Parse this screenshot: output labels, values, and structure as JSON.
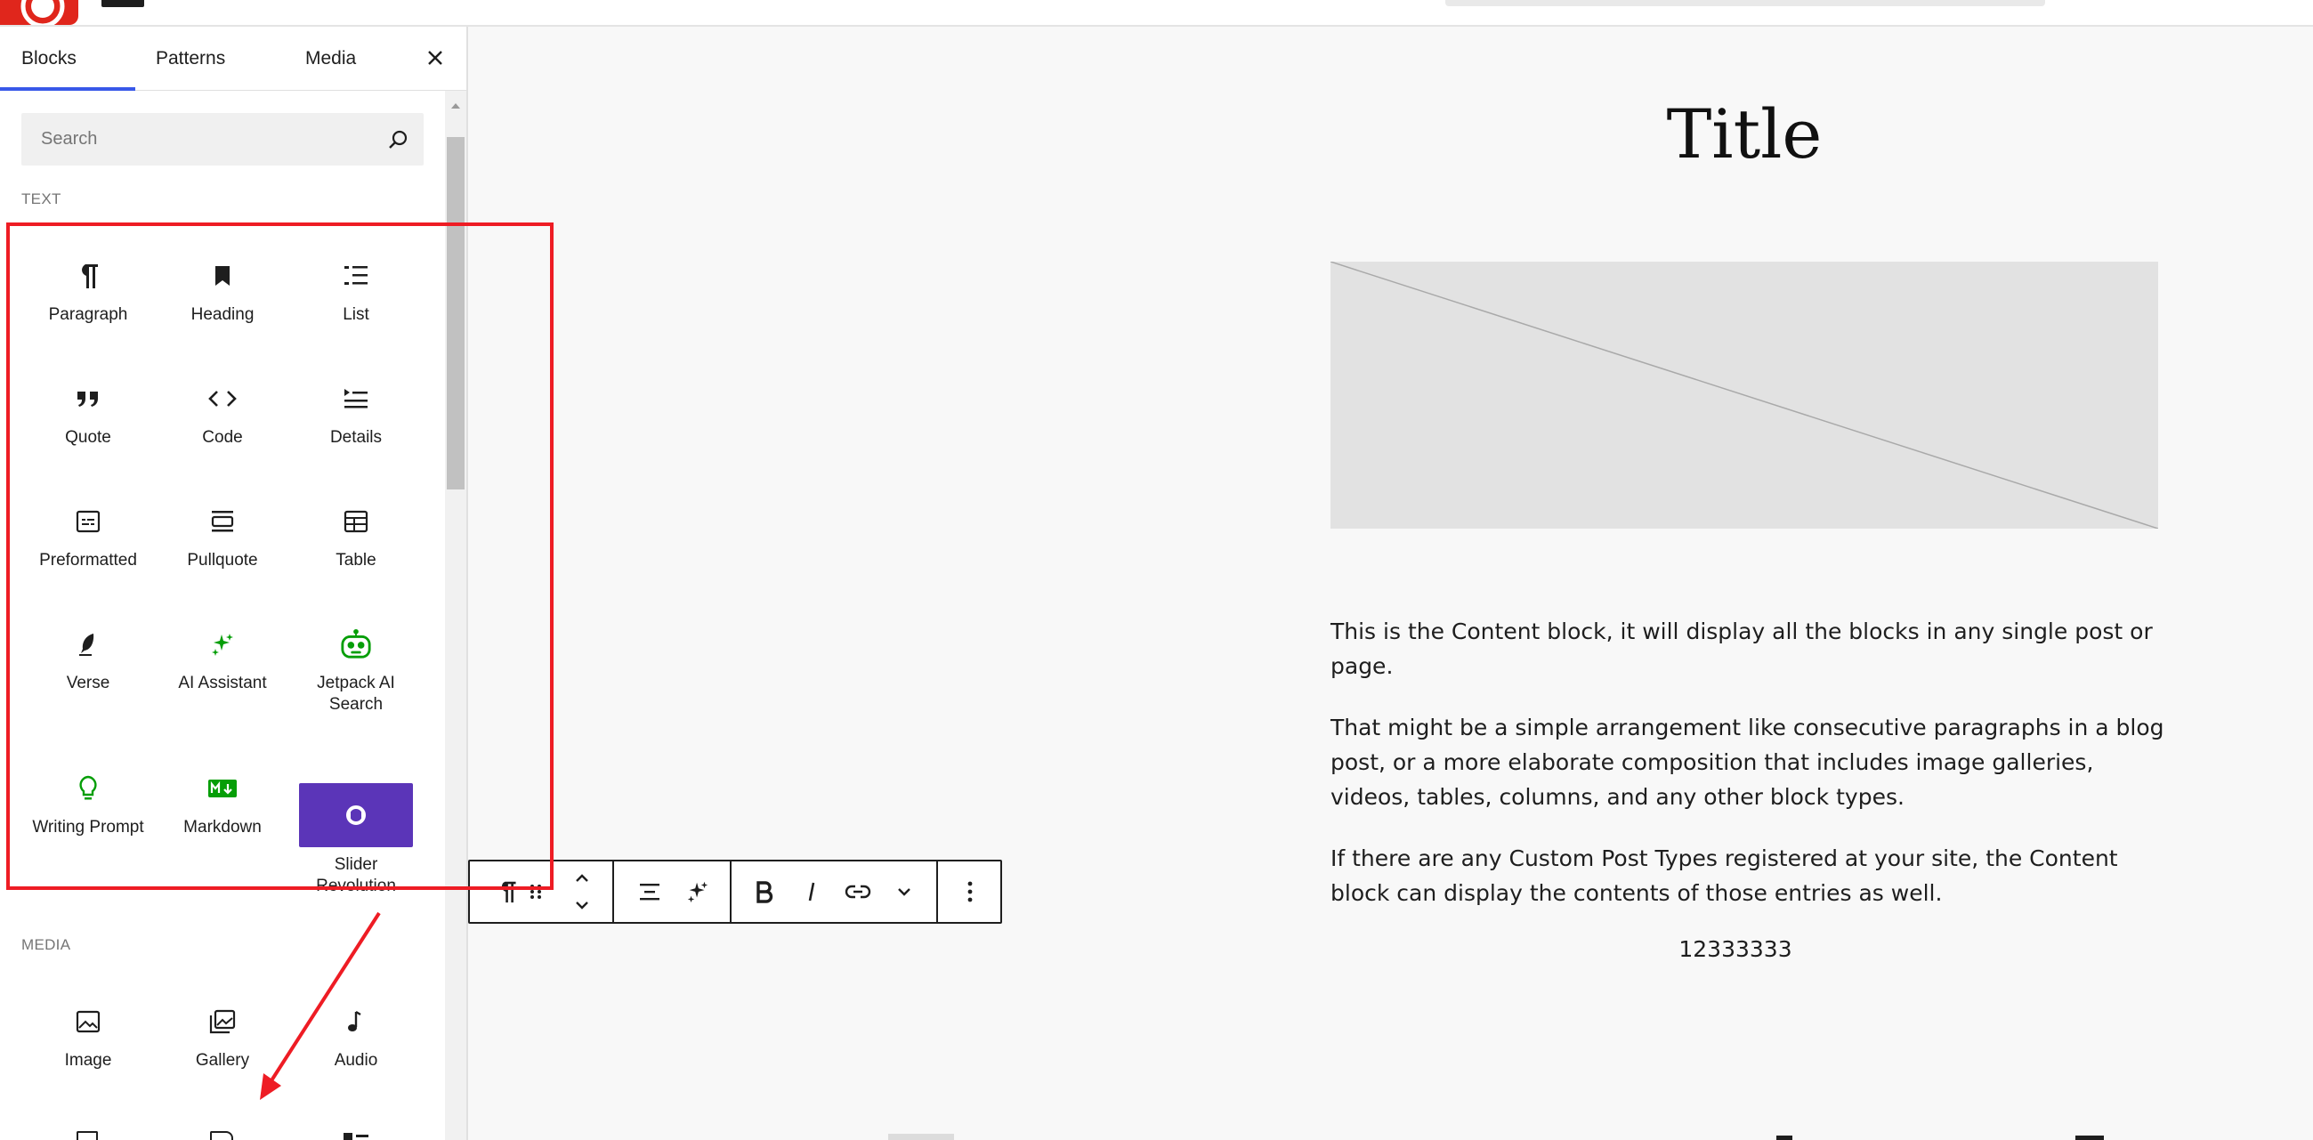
{
  "sidebar": {
    "tabs": [
      {
        "label": "Blocks"
      },
      {
        "label": "Patterns"
      },
      {
        "label": "Media"
      }
    ],
    "search_placeholder": "Search",
    "categories": {
      "text": "TEXT",
      "media": "MEDIA"
    },
    "text_blocks": [
      {
        "label": "Paragraph",
        "icon": "paragraph-icon"
      },
      {
        "label": "Heading",
        "icon": "heading-icon"
      },
      {
        "label": "List",
        "icon": "list-icon"
      },
      {
        "label": "Quote",
        "icon": "quote-icon"
      },
      {
        "label": "Code",
        "icon": "code-icon"
      },
      {
        "label": "Details",
        "icon": "details-icon"
      },
      {
        "label": "Preformatted",
        "icon": "preformatted-icon"
      },
      {
        "label": "Pullquote",
        "icon": "pullquote-icon"
      },
      {
        "label": "Table",
        "icon": "table-icon"
      },
      {
        "label": "Verse",
        "icon": "verse-icon"
      },
      {
        "label": "AI Assistant",
        "icon": "ai-assistant-icon"
      },
      {
        "label": "Jetpack AI Search",
        "icon": "jetpack-ai-search-icon"
      },
      {
        "label": "Writing Prompt",
        "icon": "writing-prompt-icon"
      },
      {
        "label": "Markdown",
        "icon": "markdown-icon"
      },
      {
        "label": "Slider Revolution",
        "icon": "slider-revolution-icon"
      }
    ],
    "media_blocks": [
      {
        "label": "Image",
        "icon": "image-icon"
      },
      {
        "label": "Gallery",
        "icon": "gallery-icon"
      },
      {
        "label": "Audio",
        "icon": "audio-icon"
      }
    ]
  },
  "content": {
    "title": "Title",
    "paragraphs": [
      "This is the Content block, it will display all the blocks in any single post or page.",
      "That might be a simple arrangement like consecutive paragraphs in a blog post, or a more elaborate composition that includes image galleries, videos, tables, columns, and any other block types.",
      "If there are any Custom Post Types registered at your site, the Content block can display the contents of those entries as well."
    ],
    "number": "12333333"
  },
  "colors": {
    "accent": "#3858e9",
    "jetpack_green": "#069e08",
    "slider_purple": "#5b35b8",
    "annotation_red": "#ee1c24"
  }
}
